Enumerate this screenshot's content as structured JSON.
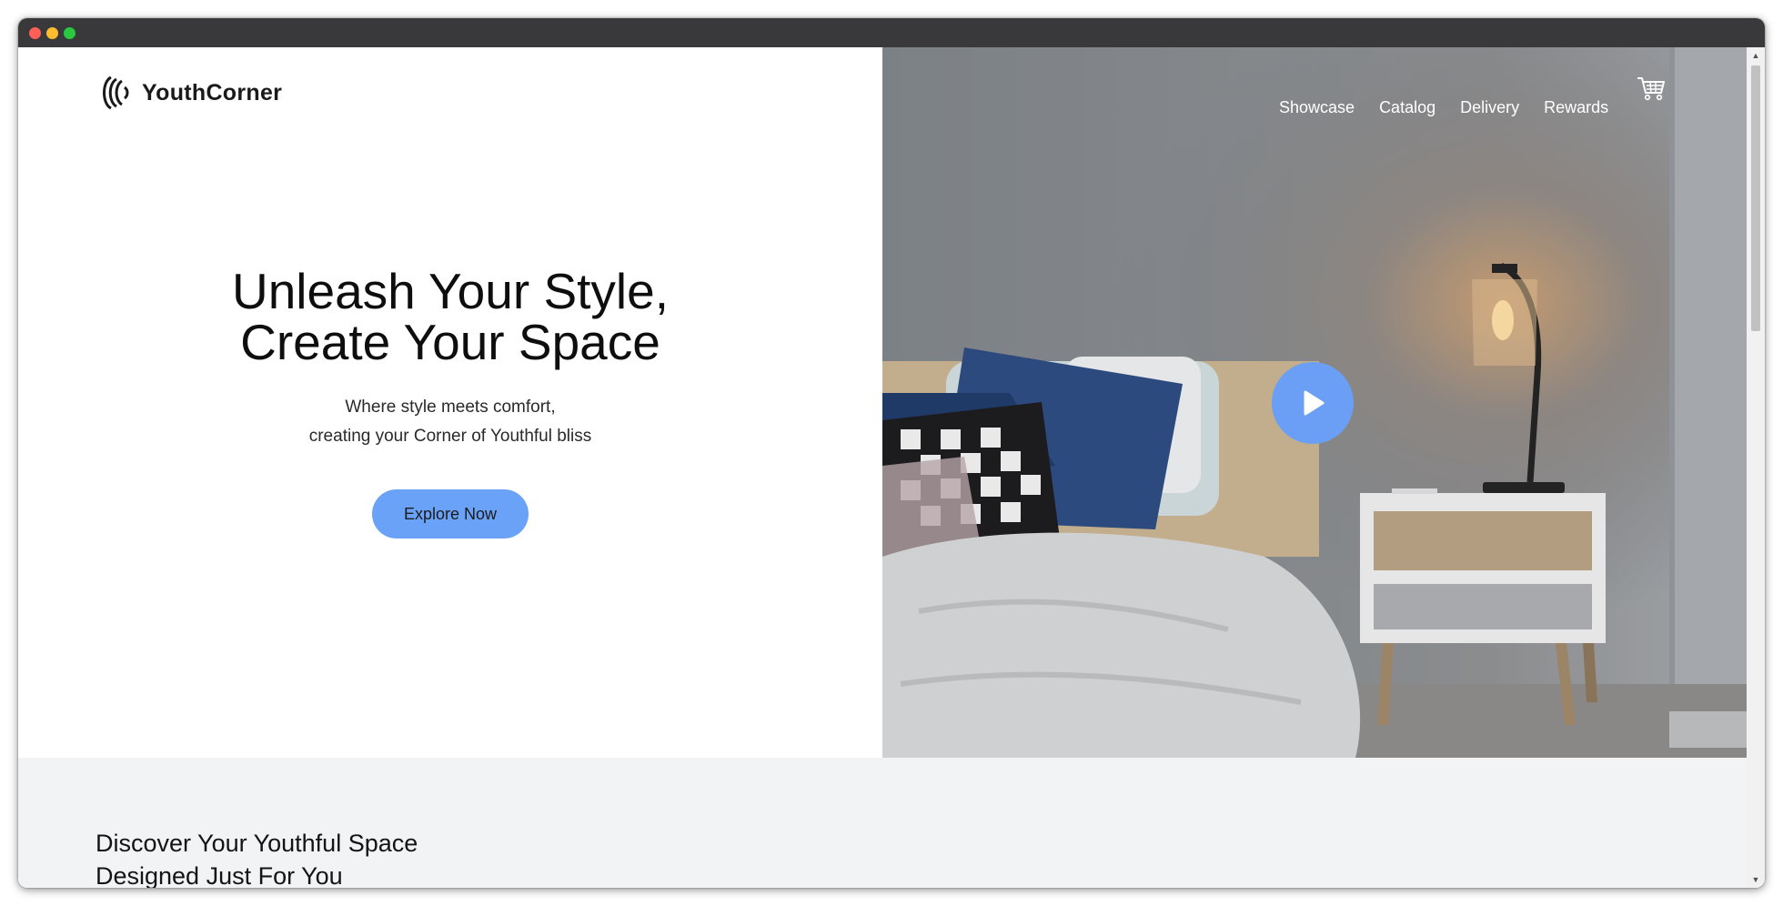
{
  "window": {
    "traffic_lights": [
      "close",
      "minimize",
      "maximize"
    ]
  },
  "header": {
    "brand": "YouthCorner",
    "nav": [
      "Showcase",
      "Catalog",
      "Delivery",
      "Rewards"
    ],
    "cart_icon": "cart-icon"
  },
  "hero": {
    "title_line1": "Unleash Your Style,",
    "title_line2": "Create Your Space",
    "subtitle_line1": "Where style meets comfort,",
    "subtitle_line2": "creating your Corner of Youthful bliss",
    "cta_label": "Explore Now",
    "play_icon": "play-icon"
  },
  "discover": {
    "title_line1": "Discover Your Youthful Space",
    "title_line2": "Designed Just For You"
  },
  "colors": {
    "accent": "#6aa2f8",
    "play_button": "#6a9ff5",
    "section_bg": "#f2f3f5",
    "titlebar": "#39393b"
  }
}
